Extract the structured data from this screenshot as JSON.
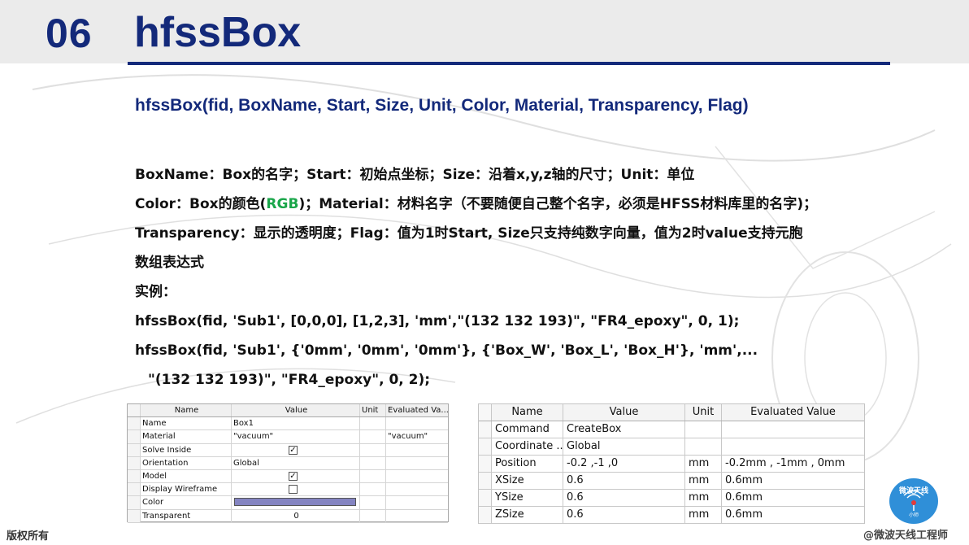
{
  "header": {
    "number": "06",
    "title": "hfssBox"
  },
  "signature": "hfssBox(fid, BoxName, Start, Size, Unit, Color, Material, Transparency, Flag)",
  "description": {
    "line1": "BoxName：Box的名字；Start：初始点坐标；Size：沿着x,y,z轴的尺寸；Unit：单位",
    "line2_prefix": "Color：Box的颜色(",
    "line2_rgb": "RGB",
    "line2_suffix": ")；Material：材料名字（不要随便自己整个名字，必须是HFSS材料库里的名字)；",
    "line3": "Transparency：显示的透明度；Flag：值为1时Start, Size只支持纯数字向量，值为2时value支持元胞",
    "line4": "数组表达式",
    "example_label": "实例：",
    "example1": "hfssBox(fid, 'Sub1', [0,0,0], [1,2,3], 'mm',\"(132 132 193)\", \"FR4_epoxy\", 0, 1);",
    "example2": "hfssBox(fid, 'Sub1', {'0mm', '0mm', '0mm'}, {'Box_W', 'Box_L', 'Box_H'}, 'mm',...",
    "example3": "\"(132 132 193)\", \"FR4_epoxy\", 0, 2);"
  },
  "left_grid": {
    "headers": [
      "Name",
      "Value",
      "Unit",
      "Evaluated Va..."
    ],
    "rows": [
      {
        "name": "Name",
        "value": "Box1",
        "unit": "",
        "evaluated": ""
      },
      {
        "name": "Material",
        "value": "\"vacuum\"",
        "unit": "",
        "evaluated": "\"vacuum\""
      },
      {
        "name": "Solve Inside",
        "value": "✓",
        "unit": "",
        "evaluated": ""
      },
      {
        "name": "Orientation",
        "value": "Global",
        "unit": "",
        "evaluated": ""
      },
      {
        "name": "Model",
        "value": "✓",
        "unit": "",
        "evaluated": ""
      },
      {
        "name": "Display Wireframe",
        "value": "",
        "unit": "",
        "evaluated": ""
      },
      {
        "name": "Color",
        "value": "",
        "unit": "",
        "evaluated": ""
      },
      {
        "name": "Transparent",
        "value": "0",
        "unit": "",
        "evaluated": ""
      }
    ],
    "color_swatch": "#8484c1"
  },
  "right_grid": {
    "headers": [
      "Name",
      "Value",
      "Unit",
      "Evaluated Value"
    ],
    "rows": [
      {
        "name": "Command",
        "value": "CreateBox",
        "unit": "",
        "evaluated": ""
      },
      {
        "name": "Coordinate ...",
        "value": "Global",
        "unit": "",
        "evaluated": ""
      },
      {
        "name": "Position",
        "value": "-0.2 ,-1 ,0",
        "unit": "mm",
        "evaluated": "-0.2mm , -1mm , 0mm"
      },
      {
        "name": "XSize",
        "value": "0.6",
        "unit": "mm",
        "evaluated": "0.6mm"
      },
      {
        "name": "YSize",
        "value": "0.6",
        "unit": "mm",
        "evaluated": "0.6mm"
      },
      {
        "name": "ZSize",
        "value": "0.6",
        "unit": "mm",
        "evaluated": "0.6mm"
      }
    ]
  },
  "footer": {
    "copyright": "版权所有",
    "author": "@微波天线工程师"
  },
  "badge": {
    "top": "微波天线",
    "sub": "小师"
  },
  "colors": {
    "brand": "#13297a",
    "rgb_highlight": "#1aa64a",
    "header_band": "#ebebeb"
  }
}
